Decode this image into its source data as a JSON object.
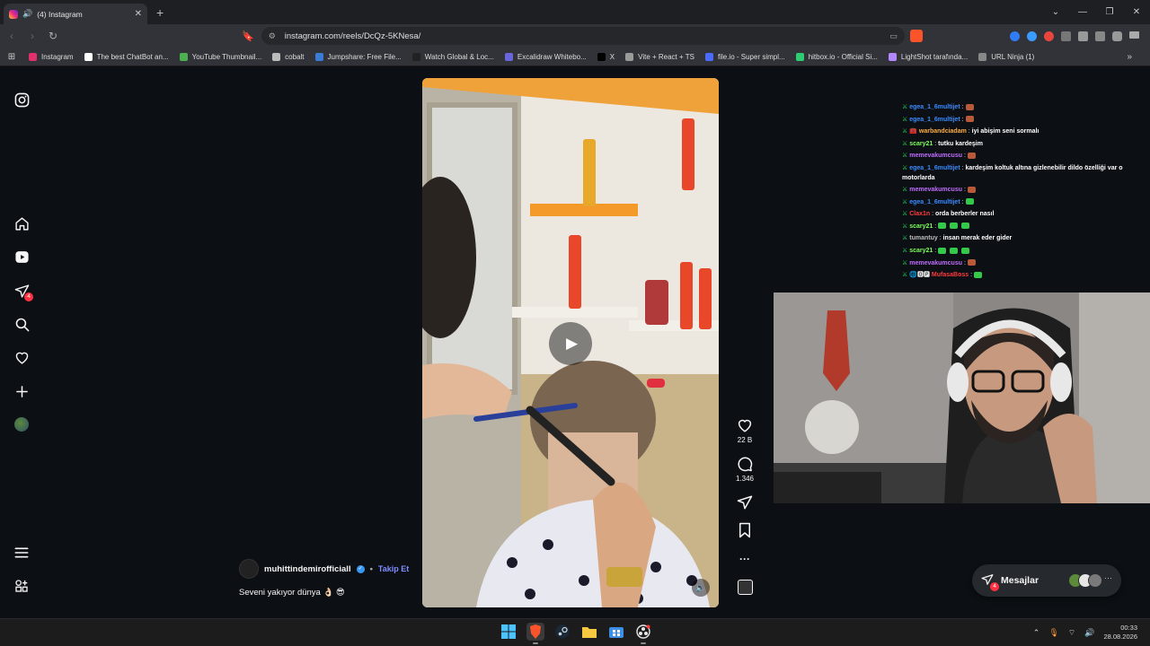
{
  "browser": {
    "tab": {
      "title": "(4) Instagram",
      "speaker": "🔊",
      "close": "✕"
    },
    "new_tab": "+",
    "window_controls": {
      "list": "⌄",
      "minimize": "—",
      "restore": "❐",
      "close": "✕"
    },
    "nav": {
      "back": "‹",
      "forward": "›",
      "reload": "↻",
      "bookmark": "🔖",
      "site_info": "⚙",
      "cast": "▭"
    },
    "url": "instagram.com/reels/DcQz-5KNesa/",
    "bookmarks_apps": "⊞",
    "bookmarks": [
      {
        "label": "Instagram",
        "color": "#e1306c"
      },
      {
        "label": "The best ChatBot an...",
        "color": "#ffffff"
      },
      {
        "label": "YouTube Thumbnail...",
        "color": "#4caf50"
      },
      {
        "label": "cobalt",
        "color": "#bbbbbb"
      },
      {
        "label": "Jumpshare: Free File...",
        "color": "#3a7bd5"
      },
      {
        "label": "Watch Global & Loc...",
        "color": "#222222"
      },
      {
        "label": "Excalidraw Whitebo...",
        "color": "#6965db"
      },
      {
        "label": "X",
        "color": "#000000"
      },
      {
        "label": "Vite + React + TS",
        "color": "#9a9a9a"
      },
      {
        "label": "file.io - Super simpl...",
        "color": "#4b6bfb"
      },
      {
        "label": "hitbox.io - Official Si...",
        "color": "#2ecc71"
      },
      {
        "label": "LightShot tarafında...",
        "color": "#b388ff"
      },
      {
        "label": "URL Ninja (1)",
        "color": "#888888"
      }
    ],
    "bookmarks_more": "»"
  },
  "sidebar": {
    "notifications_badge": "4"
  },
  "reel": {
    "play_icon": "▶",
    "mute_icon": "🔈",
    "likes": "22 B",
    "comments": "1.346",
    "author": "muhittindemirofficiall",
    "verified_mark": "✓",
    "separator": "•",
    "follow": "Takip Et",
    "caption": "Seveni yakıyor dünya 👌🏻 😎",
    "more": "···"
  },
  "chat": [
    {
      "badge": "",
      "user": "egea_1_6multijet",
      "msg": "",
      "color": "#3a8bff",
      "emote": "#b85a3a"
    },
    {
      "badge": "",
      "user": "egea_1_6multijet",
      "msg": "",
      "color": "#3a8bff",
      "emote": "#b85a3a"
    },
    {
      "badge": "🧰",
      "user": "warbandciadam",
      "msg": "iyi abişim seni sormalı",
      "color": "#ffae42",
      "emote": ""
    },
    {
      "badge": "",
      "user": "scary21",
      "msg": "tutku kardeşim",
      "color": "#7cff5b",
      "emote": ""
    },
    {
      "badge": "",
      "user": "memevakumcusu",
      "msg": "",
      "color": "#c06bff",
      "emote": "#b85a3a"
    },
    {
      "badge": "",
      "user": "egea_1_6multijet",
      "msg": "kardeşim koltuk altına gizlenebilir dildo özelliği var o motorlarda",
      "color": "#3a8bff",
      "emote": "",
      "wrap": true
    },
    {
      "badge": "",
      "user": "memevakumcusu",
      "msg": "",
      "color": "#c06bff",
      "emote": "#b85a3a"
    },
    {
      "badge": "",
      "user": "egea_1_6multijet",
      "msg": "",
      "color": "#3a8bff",
      "emote": "#35c94b"
    },
    {
      "badge": "",
      "user": "Clax1n",
      "msg": "orda berberler nasıl",
      "color": "#ff3b3b",
      "emote": ""
    },
    {
      "badge": "",
      "user": "scary21",
      "msg": "",
      "color": "#7cff5b",
      "emote": "#35c94b",
      "emote_count": 3
    },
    {
      "badge": "",
      "user": "tumantuy",
      "msg": "insan merak eder gider",
      "color": "#bdbdbd",
      "emote": ""
    },
    {
      "badge": "",
      "user": "scary21",
      "msg": "",
      "color": "#7cff5b",
      "emote": "#35c94b",
      "emote_count": 3
    },
    {
      "badge": "",
      "user": "memevakumcusu",
      "msg": "",
      "color": "#c06bff",
      "emote": "#b85a3a"
    },
    {
      "badge": "🌐🅾🅿",
      "user": "MufasaBoss",
      "msg": "",
      "color": "#ff3b3b",
      "emote": "#35c94b"
    }
  ],
  "chat_sword": "⚔",
  "messages": {
    "label": "Mesajlar",
    "badge": "4",
    "more": "···"
  },
  "taskbar": {
    "time": "00:33",
    "date": "28.08.2026",
    "tray": {
      "up": "⌃",
      "mic": "🎙",
      "network": "⌔",
      "volume": "🔊"
    }
  },
  "colors": {
    "accent_follow": "#7f8cff",
    "badge_red": "#ff3040",
    "page_bg": "#0c1014"
  }
}
